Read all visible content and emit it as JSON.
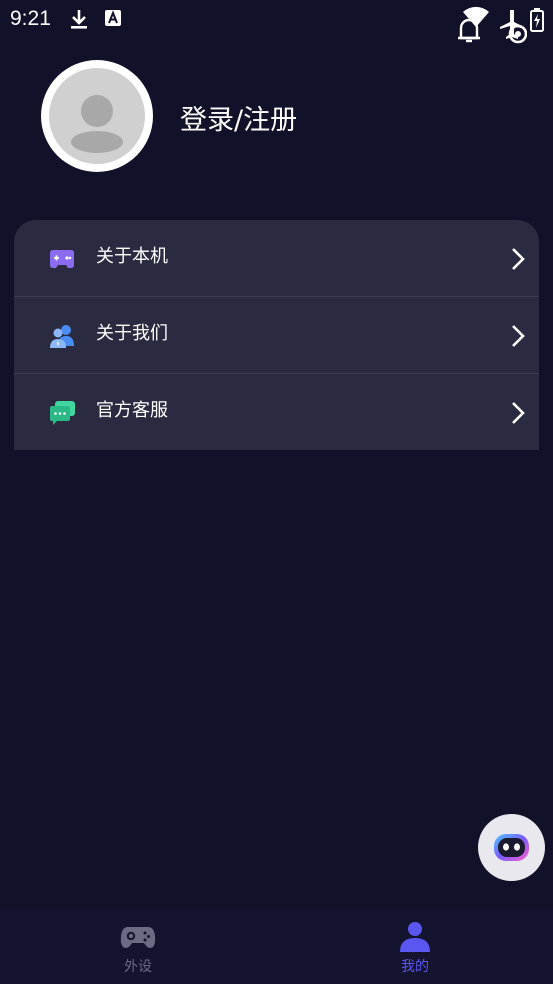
{
  "status_bar": {
    "time": "9:21",
    "icons": [
      "download-icon",
      "a-box-icon",
      "notification-bell-icon",
      "wifi-icon",
      "airplane-icon",
      "battery-icon"
    ]
  },
  "profile": {
    "login_label": "登录/注册"
  },
  "menu": {
    "items": [
      {
        "label": "关于本机",
        "icon": "device-icon"
      },
      {
        "label": "关于我们",
        "icon": "users-icon"
      },
      {
        "label": "官方客服",
        "icon": "chat-icon"
      }
    ]
  },
  "bottom_nav": {
    "tabs": [
      {
        "label": "外设",
        "icon": "gamepad-icon",
        "active": false
      },
      {
        "label": "我的",
        "icon": "person-icon",
        "active": true
      }
    ]
  },
  "colors": {
    "background": "#12112a",
    "card": "#2a2a40",
    "nav_active": "#5a57f0",
    "nav_inactive": "#6b6b85"
  }
}
